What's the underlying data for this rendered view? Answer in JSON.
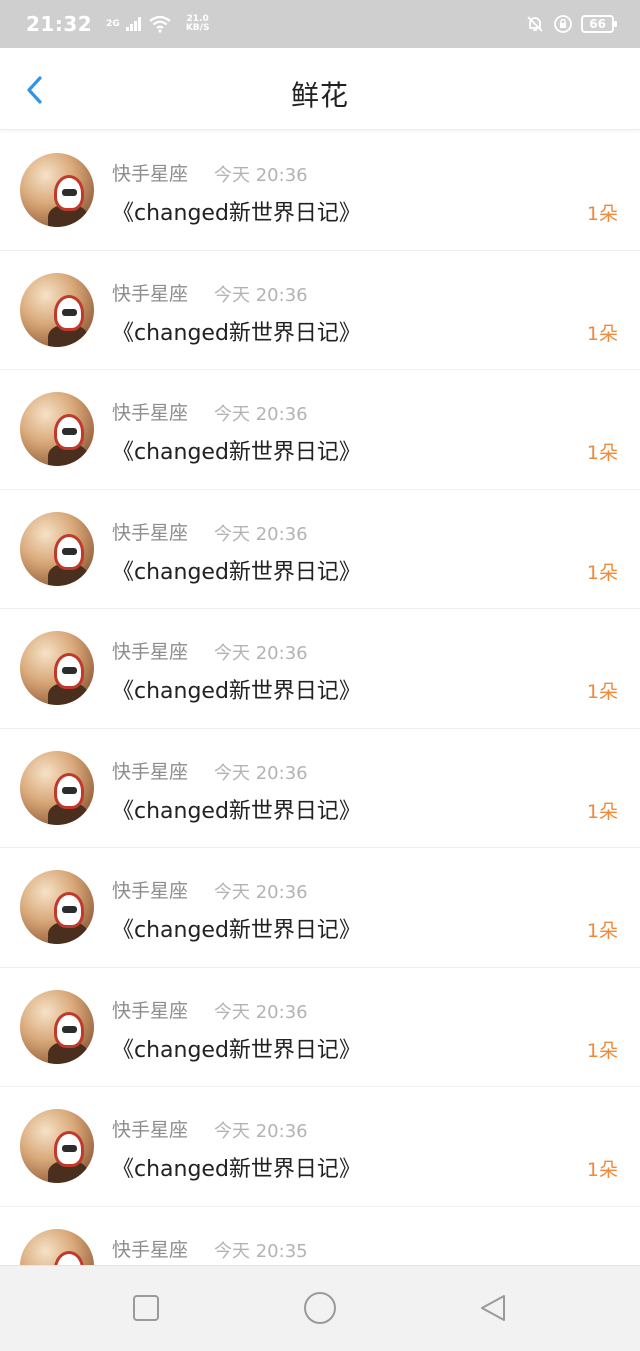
{
  "status_bar": {
    "time": "21:32",
    "network_type": "2G",
    "speed_value": "21.0",
    "speed_unit": "KB/S",
    "battery": "66"
  },
  "header": {
    "title": "鲜花",
    "back_icon": "chevron-left-icon",
    "accent": "#2f96e6"
  },
  "rows": [
    {
      "name": "快手星座",
      "time": "今天 20:36",
      "work": "《changed新世界日记》",
      "count": "1朵"
    },
    {
      "name": "快手星座",
      "time": "今天 20:36",
      "work": "《changed新世界日记》",
      "count": "1朵"
    },
    {
      "name": "快手星座",
      "time": "今天 20:36",
      "work": "《changed新世界日记》",
      "count": "1朵"
    },
    {
      "name": "快手星座",
      "time": "今天 20:36",
      "work": "《changed新世界日记》",
      "count": "1朵"
    },
    {
      "name": "快手星座",
      "time": "今天 20:36",
      "work": "《changed新世界日记》",
      "count": "1朵"
    },
    {
      "name": "快手星座",
      "time": "今天 20:36",
      "work": "《changed新世界日记》",
      "count": "1朵"
    },
    {
      "name": "快手星座",
      "time": "今天 20:36",
      "work": "《changed新世界日记》",
      "count": "1朵"
    },
    {
      "name": "快手星座",
      "time": "今天 20:36",
      "work": "《changed新世界日记》",
      "count": "1朵"
    },
    {
      "name": "快手星座",
      "time": "今天 20:36",
      "work": "《changed新世界日记》",
      "count": "1朵"
    },
    {
      "name": "快手星座",
      "time": "今天 20:35",
      "work": "",
      "count": ""
    }
  ],
  "colors": {
    "count": "#f08a3a",
    "name": "#8d8d8d",
    "time": "#b3b3b3"
  },
  "nav_bar": {
    "recent_icon": "square-icon",
    "home_icon": "circle-icon",
    "back_icon": "triangle-back-icon"
  }
}
